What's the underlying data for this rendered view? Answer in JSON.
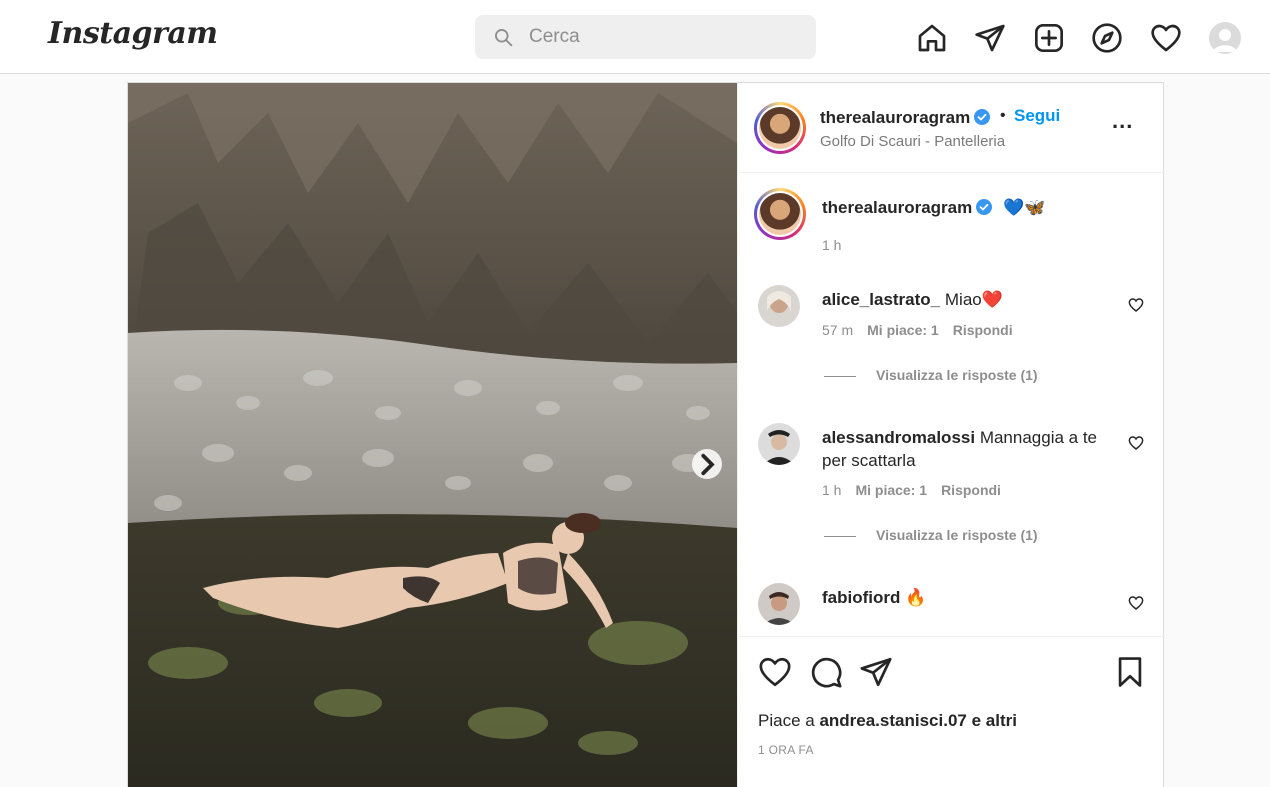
{
  "brand": {
    "logo_text": "Instagram"
  },
  "search": {
    "placeholder": "Cerca",
    "value": ""
  },
  "nav": {
    "icons": [
      "home-icon",
      "direct-icon",
      "new-post-icon",
      "explore-icon",
      "activity-icon",
      "profile-avatar"
    ]
  },
  "post": {
    "username": "therealauroragram",
    "dot": "•",
    "follow_label": "Segui",
    "location": "Golfo Di Scauri - Pantelleria",
    "more_label": "...",
    "caption": {
      "username": "therealauroragram",
      "emoji": "💙🦋",
      "time": "1 h"
    },
    "comments": [
      {
        "username": "alice_lastrato_",
        "text": "Miao❤️",
        "time": "57 m",
        "likes": "Mi piace: 1",
        "reply": "Rispondi",
        "view_replies": "Visualizza le risposte (1)"
      },
      {
        "username": "alessandromalossi",
        "text": "Mannaggia a te per scattarla",
        "time": "1 h",
        "likes": "Mi piace: 1",
        "reply": "Rispondi",
        "view_replies": "Visualizza le risposte (1)"
      },
      {
        "username": "fabiofiord",
        "text": "🔥"
      }
    ],
    "liked_by_prefix": "Piace a",
    "liked_by_user": "andrea.stanisci.07",
    "liked_by_suffix": "e altri",
    "timestamp": "1 ORA FA"
  },
  "colors": {
    "accent": "#0095f6",
    "verified": "#3897f0",
    "text": "#262626",
    "muted": "#8e8e8e"
  }
}
